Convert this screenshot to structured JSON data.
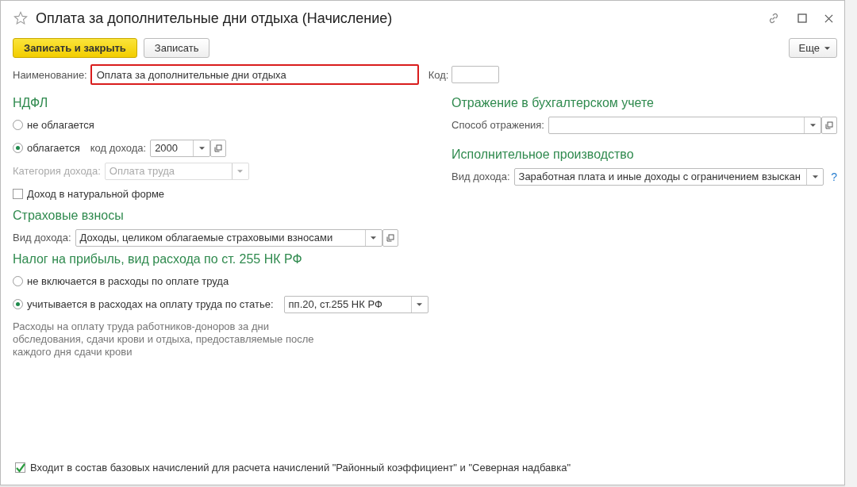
{
  "window": {
    "title": "Оплата за дополнительные дни отдыха (Начисление)"
  },
  "toolbar": {
    "buttons": [
      {
        "label": "Записать и закрыть",
        "kind": "primary"
      },
      {
        "label": "Записать",
        "kind": "default"
      }
    ],
    "more": "Еще"
  },
  "name_field": {
    "label": "Наименование:",
    "value": "Оплата за дополнительные дни отдыха",
    "highlighted": true
  },
  "code_field": {
    "label": "Код:"
  },
  "ndfl": {
    "title": "НДФЛ",
    "options": [
      {
        "label": "не облагается",
        "selected": false
      },
      {
        "label": "облагается",
        "selected": true,
        "field": {
          "label": "код дохода:",
          "value": "2000"
        }
      }
    ],
    "category": {
      "label": "Категория дохода:",
      "value": "Оплата труда",
      "disabled": true
    },
    "in_kind": {
      "label": "Доход в натуральной форме",
      "checked": false
    }
  },
  "insurance": {
    "title": "Страховые взносы",
    "field": {
      "label": "Вид дохода:",
      "value": "Доходы, целиком облагаемые страховыми взносами"
    }
  },
  "profit_tax": {
    "title": "Налог на прибыль, вид расхода по ст. 255 НК РФ",
    "options": [
      {
        "label": "не включается в расходы по оплате труда",
        "selected": false
      },
      {
        "label": "учитывается в расходах на оплату труда по статье:",
        "selected": true,
        "field": {
          "value": "пп.20, ст.255 НК РФ"
        }
      }
    ],
    "description": "Расходы на оплату труда работников-доноров за дни обследования, сдачи крови и отдыха, предоставляемые после каждого дня сдачи крови"
  },
  "accounting": {
    "title": "Отражение в бухгалтерском учете",
    "field": {
      "label": "Способ отражения:"
    }
  },
  "enforcement": {
    "title": "Исполнительное производство",
    "field": {
      "label": "Вид дохода:",
      "value": "Заработная плата и иные доходы с ограничением взыскан"
    },
    "help": "?"
  },
  "base_accruals": {
    "label": "Входит в состав базовых начислений для расчета начислений \"Районный коэффициент\" и \"Северная надбавка\"",
    "checked": true
  }
}
